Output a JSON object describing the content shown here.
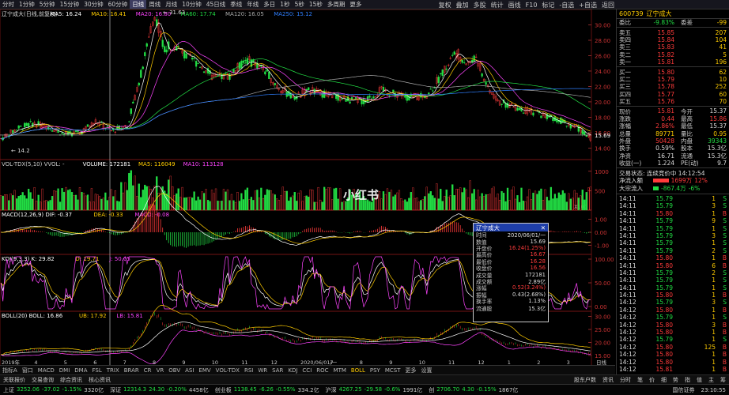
{
  "toolbar": {
    "items": [
      "分时",
      "1分钟",
      "5分钟",
      "15分钟",
      "30分钟",
      "60分钟",
      "日线",
      "周线",
      "月线",
      "10分钟",
      "45日线",
      "季线",
      "年线",
      "多日",
      "1秒",
      "5秒",
      "15秒",
      "多周期",
      "更多"
    ],
    "active_index": 6,
    "right_items": [
      "复权",
      "叠加",
      "多股",
      "统计",
      "画线",
      "F10",
      "标记",
      "-自选",
      "+自选",
      "返回"
    ]
  },
  "main_chart": {
    "title": "辽宁成大(日线,前复权)",
    "ma_labels": [
      {
        "text": "MA5: 16.24",
        "color": "#ffffff"
      },
      {
        "text": "MA10: 16.41",
        "color": "#ffcc00"
      },
      {
        "text": "MA20: 16.80",
        "color": "#ff44ff"
      },
      {
        "text": "MA60: 17.74",
        "color": "#22dd44"
      },
      {
        "text": "MA120: 16.05",
        "color": "#aaaaaa"
      },
      {
        "text": "MA250: 15.12",
        "color": "#2f7fff"
      }
    ],
    "y_ticks": [
      "30.00",
      "28.00",
      "26.00",
      "24.00",
      "22.00",
      "20.00",
      "18.00",
      "16.00",
      "14.00"
    ],
    "high_label": "31.63",
    "low_label": "14.2",
    "current_price_label": "15.69"
  },
  "vol_chart": {
    "labels": [
      {
        "text": "VOL-TDX(5,10) VVOL: -",
        "color": "#cccccc"
      },
      {
        "text": "VOLUME: 172181",
        "color": "#ffffff"
      },
      {
        "text": "MA5: 116049",
        "color": "#ffcc00"
      },
      {
        "text": "MA10: 113128",
        "color": "#ff44ff"
      }
    ],
    "y_ticks": [
      "1000",
      "500"
    ],
    "unit": "X100"
  },
  "macd_chart": {
    "labels": [
      {
        "text": "MACD(12,26,9) DIF: -0.37",
        "color": "#ffffff"
      },
      {
        "text": "DEA: -0.33",
        "color": "#ffcc00"
      },
      {
        "text": "MACD: -0.08",
        "color": "#ff44ff"
      }
    ],
    "y_ticks": [
      "1.00",
      "0.00",
      "-1.00"
    ]
  },
  "kdj_chart": {
    "labels": [
      {
        "text": "KDJ(9,3,3) K: 29.82",
        "color": "#ffffff"
      },
      {
        "text": "D: 19.71",
        "color": "#ffcc00"
      },
      {
        "text": "J: 50.05",
        "color": "#ff44ff"
      }
    ],
    "y_ticks": [
      "100.00",
      "50.00",
      "0.00"
    ]
  },
  "boll_chart": {
    "labels": [
      {
        "text": "BOLL(20) BOLL: 16.86",
        "color": "#ffffff"
      },
      {
        "text": "UB: 17.92",
        "color": "#ffcc00"
      },
      {
        "text": "LB: 15.81",
        "color": "#ff44ff"
      }
    ],
    "y_ticks": [
      "30.00",
      "25.00",
      "20.00",
      "15.00"
    ]
  },
  "x_axis": {
    "labels": [
      "2019年",
      "4",
      "5",
      "6",
      "7",
      "8",
      "9",
      "10",
      "11",
      "12",
      "2020/06/01/一",
      "7",
      "8",
      "9",
      "10",
      "11",
      "12",
      "1",
      "2",
      "3"
    ],
    "unit": "日线"
  },
  "indicator_bar": [
    "指标A",
    "窗口",
    "MACD",
    "DMI",
    "DMA",
    "FSL",
    "TRIX",
    "BRAR",
    "CR",
    "VR",
    "OBV",
    "ASI",
    "EMV",
    "VOL-TDX",
    "RSI",
    "WR",
    "SAR",
    "KDJ",
    "CCI",
    "ROC",
    "MTM",
    "BOLL",
    "PSY",
    "MCST",
    "更多",
    "设置"
  ],
  "indicator_active": "BOLL",
  "popup": {
    "title": "辽宁成大",
    "rows": [
      {
        "k": "时间",
        "v": "2020/06/01/一",
        "c": "#dddddd"
      },
      {
        "k": "数值",
        "v": "15.69",
        "c": "#dddddd"
      },
      {
        "k": "开盘价",
        "v": "16.24(1.25%)",
        "c": "#ff3b3b"
      },
      {
        "k": "最高价",
        "v": "16.67",
        "c": "#ff3b3b"
      },
      {
        "k": "最低价",
        "v": "16.28",
        "c": "#ff3b3b"
      },
      {
        "k": "收盘价",
        "v": "16.56",
        "c": "#ff3b3b"
      },
      {
        "k": "成交量",
        "v": "172181",
        "c": "#dddddd"
      },
      {
        "k": "成交额",
        "v": "2.89亿",
        "c": "#dddddd"
      },
      {
        "k": "涨幅",
        "v": "0.52(3.24%)",
        "c": "#ff3b3b"
      },
      {
        "k": "振幅",
        "v": "0.43(2.68%)",
        "c": "#dddddd"
      },
      {
        "k": "换手率",
        "v": "1.13%",
        "c": "#dddddd"
      },
      {
        "k": "流通股",
        "v": "15.3亿",
        "c": "#dddddd"
      }
    ]
  },
  "watermark": "小红书",
  "panel": {
    "code": "600739",
    "name": "辽宁成大",
    "weibi": {
      "label": "委比",
      "value": "-9.83%",
      "label2": "委差",
      "value2": "-99"
    },
    "sells": [
      {
        "label": "卖五",
        "price": "15.85",
        "vol": "207"
      },
      {
        "label": "卖四",
        "price": "15.84",
        "vol": "104"
      },
      {
        "label": "卖三",
        "price": "15.83",
        "vol": "41"
      },
      {
        "label": "卖二",
        "price": "15.82",
        "vol": "5"
      },
      {
        "label": "卖一",
        "price": "15.81",
        "vol": "196"
      }
    ],
    "buys": [
      {
        "label": "买一",
        "price": "15.80",
        "vol": "62"
      },
      {
        "label": "买二",
        "price": "15.79",
        "vol": "10"
      },
      {
        "label": "买三",
        "price": "15.78",
        "vol": "252"
      },
      {
        "label": "买四",
        "price": "15.77",
        "vol": "60"
      },
      {
        "label": "买五",
        "price": "15.76",
        "vol": "70"
      }
    ],
    "quote": [
      {
        "l1": "现价",
        "v1": "15.81",
        "c1": "#ff3b3b",
        "l2": "今开",
        "v2": "15.37",
        "c2": "#dddddd"
      },
      {
        "l1": "涨跌",
        "v1": "0.44",
        "c1": "#ff3b3b",
        "l2": "最高",
        "v2": "15.86",
        "c2": "#ff3b3b"
      },
      {
        "l1": "涨幅",
        "v1": "2.86%",
        "c1": "#ff3b3b",
        "l2": "最低",
        "v2": "15.37",
        "c2": "#dddddd"
      },
      {
        "l1": "总量",
        "v1": "89771",
        "c1": "#ffcc00",
        "l2": "量比",
        "v2": "0.95",
        "c2": "#ffcc00"
      },
      {
        "l1": "外盘",
        "v1": "50428",
        "c1": "#ff3b3b",
        "l2": "内盘",
        "v2": "39343",
        "c2": "#22dd44"
      },
      {
        "l1": "换手",
        "v1": "0.59%",
        "c1": "#dddddd",
        "l2": "股本",
        "v2": "15.3亿",
        "c2": "#dddddd"
      },
      {
        "l1": "净资",
        "v1": "16.71",
        "c1": "#dddddd",
        "l2": "流通",
        "v2": "15.3亿",
        "c2": "#dddddd"
      },
      {
        "l1": "收益(一)",
        "v1": "1.224",
        "c1": "#dddddd",
        "l2": "PE(动)",
        "v2": "9.7",
        "c2": "#dddddd"
      }
    ],
    "trade_status": "交易状态: 连续竞价中 14:12:54",
    "netflow": {
      "label": "净流入额",
      "value": "1699万",
      "pct": "12%",
      "ratio": 0.7
    },
    "bigflow": {
      "label": "大宗流入",
      "value": "-867.4万",
      "pct": "-6%",
      "ratio": 0.25
    },
    "ticks": [
      {
        "t": "14:11",
        "p": "15.79",
        "v": "1",
        "bs": "S"
      },
      {
        "t": "14:11",
        "p": "15.79",
        "v": "3",
        "bs": "S"
      },
      {
        "t": "14:11",
        "p": "15.80",
        "v": "1",
        "bs": "B"
      },
      {
        "t": "14:11",
        "p": "15.79",
        "v": "9",
        "bs": "S"
      },
      {
        "t": "14:11",
        "p": "15.79",
        "v": "1",
        "bs": "S"
      },
      {
        "t": "14:11",
        "p": "15.79",
        "v": "3",
        "bs": "S"
      },
      {
        "t": "14:11",
        "p": "15.79",
        "v": "1",
        "bs": "S"
      },
      {
        "t": "14:11",
        "p": "15.79",
        "v": "2",
        "bs": "S"
      },
      {
        "t": "14:11",
        "p": "15.80",
        "v": "1",
        "bs": "B"
      },
      {
        "t": "14:11",
        "p": "15.80",
        "v": "6",
        "bs": "B"
      },
      {
        "t": "14:11",
        "p": "15.79",
        "v": "2",
        "bs": "S"
      },
      {
        "t": "14:11",
        "p": "15.79",
        "v": "1",
        "bs": "S"
      },
      {
        "t": "14:11",
        "p": "15.79",
        "v": "1",
        "bs": "S"
      },
      {
        "t": "14:11",
        "p": "15.80",
        "v": "1",
        "bs": "B"
      },
      {
        "t": "14:12",
        "p": "15.79",
        "v": "3",
        "bs": "S"
      },
      {
        "t": "14:12",
        "p": "15.80",
        "v": "1",
        "bs": "B"
      },
      {
        "t": "14:12",
        "p": "15.79",
        "v": "1",
        "bs": "S"
      },
      {
        "t": "14:12",
        "p": "15.80",
        "v": "3",
        "bs": "B"
      },
      {
        "t": "14:12",
        "p": "15.80",
        "v": "1",
        "bs": "B"
      },
      {
        "t": "14:12",
        "p": "15.79",
        "v": "1",
        "bs": "S"
      },
      {
        "t": "14:12",
        "p": "15.80",
        "v": "125",
        "bs": "B"
      },
      {
        "t": "14:12",
        "p": "15.80",
        "v": "1",
        "bs": "B"
      },
      {
        "t": "14:12",
        "p": "15.80",
        "v": "1",
        "bs": "B"
      },
      {
        "t": "14:12",
        "p": "15.81",
        "v": "1",
        "bs": "B"
      }
    ]
  },
  "func_bar": [
    "关联报价",
    "交易查询",
    "综合资讯",
    "核心资讯"
  ],
  "func_right": [
    "股东户数",
    "资讯",
    "分时",
    "笔",
    "价",
    "细",
    "势",
    "指",
    "值",
    "主",
    "筹"
  ],
  "status": [
    {
      "n": "上证",
      "v": "3252.06",
      "c": "-37.02",
      "p": "-1.15%",
      "a": "3320亿",
      "cls": "dn"
    },
    {
      "n": "深证",
      "v": "12314.3",
      "c": "24.30",
      "p": "-0.20%",
      "a": "4458亿",
      "cls": "dn"
    },
    {
      "n": "创业板",
      "v": "1138.45",
      "c": "-6.26",
      "p": "-0.55%",
      "a": "334.2亿",
      "cls": "dn"
    },
    {
      "n": "沪深",
      "v": "4267.25",
      "c": "-29.58",
      "p": "-0.6%",
      "a": "1991亿",
      "cls": "dn"
    },
    {
      "n": "创",
      "v": "2706.70",
      "c": "4.30",
      "p": "-0.15%",
      "a": "1867亿",
      "cls": "dn"
    }
  ],
  "status_right": [
    "国信证券",
    "23:10:55"
  ]
}
